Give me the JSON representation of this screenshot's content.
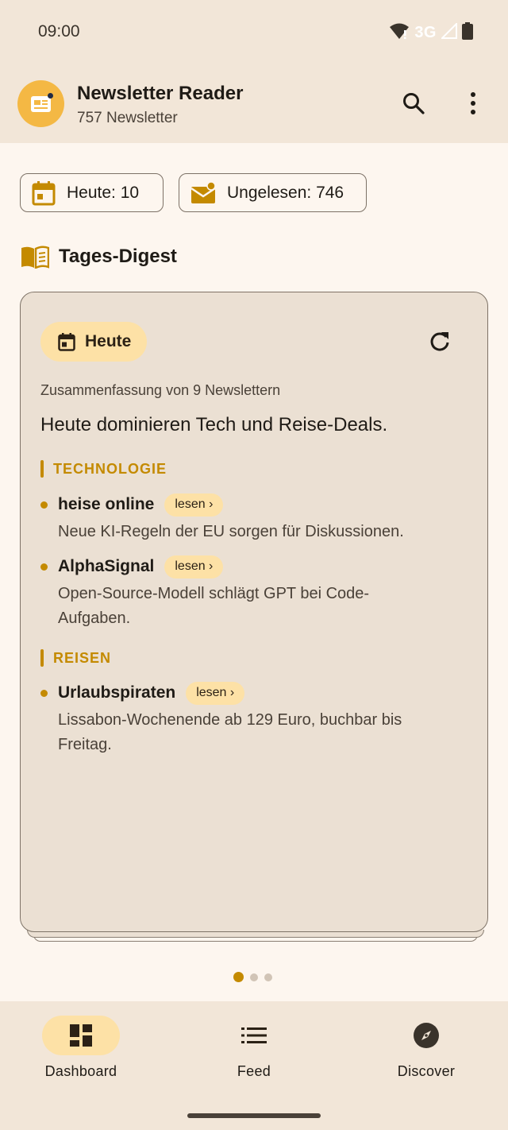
{
  "status": {
    "time": "09:00",
    "network": "3G"
  },
  "header": {
    "title": "Newsletter Reader",
    "subtitle": "757 Newsletter"
  },
  "chips": {
    "today": "Heute: 10",
    "unread": "Ungelesen: 746"
  },
  "section": {
    "title": "Tages-Digest"
  },
  "digest": {
    "day_label": "Heute",
    "meta": "Zusammenfassung von 9 Newslettern",
    "headline": "Heute dominieren Tech und Reise-Deals.",
    "categories": [
      {
        "label": "TECHNOLOGIE",
        "items": [
          {
            "source": "heise online",
            "action": "lesen ›",
            "text": "Neue KI-Regeln der EU sorgen für Diskussionen."
          },
          {
            "source": "AlphaSignal",
            "action": "lesen ›",
            "text": "Open-Source-Modell schlägt GPT bei Code-Aufgaben."
          }
        ]
      },
      {
        "label": "REISEN",
        "items": [
          {
            "source": "Urlaubspiraten",
            "action": "lesen ›",
            "text": "Lissabon-Wochenende ab 129 Euro, buchbar bis Freitag."
          }
        ]
      }
    ],
    "page_count": 3,
    "active_page": 1
  },
  "nav": {
    "items": [
      {
        "label": "Dashboard",
        "icon": "dashboard-icon",
        "active": true
      },
      {
        "label": "Feed",
        "icon": "list-icon",
        "active": false
      },
      {
        "label": "Discover",
        "icon": "compass-icon",
        "active": false
      }
    ]
  },
  "colors": {
    "accent": "#c48a00",
    "pill": "#fde1a6",
    "surface": "#f2e6d8",
    "card": "#ebe0d3"
  }
}
